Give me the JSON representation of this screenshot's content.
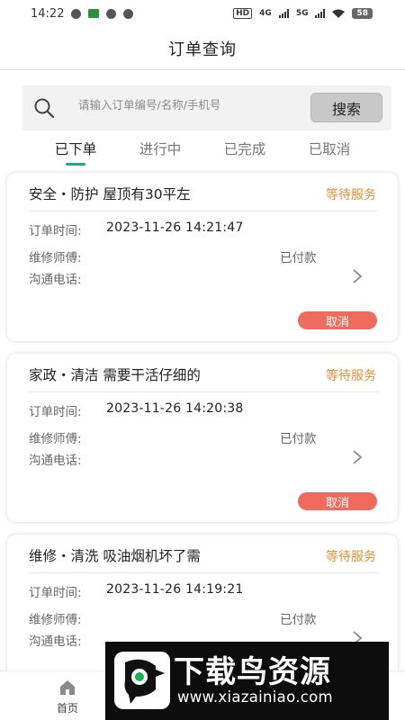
{
  "status_bar": {
    "time": "14:22",
    "network_tag_1": "HD",
    "network_tag_2": "4G",
    "network_tag_3": "5G",
    "battery": "58"
  },
  "header": {
    "title": "订单查询"
  },
  "search": {
    "placeholder": "请输入订单编号/名称/手机号",
    "button_label": "搜索"
  },
  "tabs": [
    {
      "label": "已下单",
      "active": true
    },
    {
      "label": "进行中",
      "active": false
    },
    {
      "label": "已完成",
      "active": false
    },
    {
      "label": "已取消",
      "active": false
    }
  ],
  "labels": {
    "order_time": "订单时间:",
    "technician": "维修师傅:",
    "phone": "沟通电话:",
    "paid": "已付款",
    "cancel": "取消"
  },
  "orders": [
    {
      "title": "安全・防护   屋顶有30平左",
      "status": "等待服务",
      "time": "2023-11-26 14:21:47"
    },
    {
      "title": "家政・清洁   需要干活仔细的",
      "status": "等待服务",
      "time": "2023-11-26 14:20:38"
    },
    {
      "title": "维修・清洗   吸油烟机坏了需",
      "status": "等待服务",
      "time": "2023-11-26 14:19:21"
    }
  ],
  "tabbar": {
    "home_label": "首页"
  },
  "watermark": {
    "title": "下载鸟资源",
    "url": "www.xiazainiao.com"
  },
  "colors": {
    "accent": "#27a884",
    "status": "#e0913a",
    "cancel": "#ee6b5e"
  }
}
